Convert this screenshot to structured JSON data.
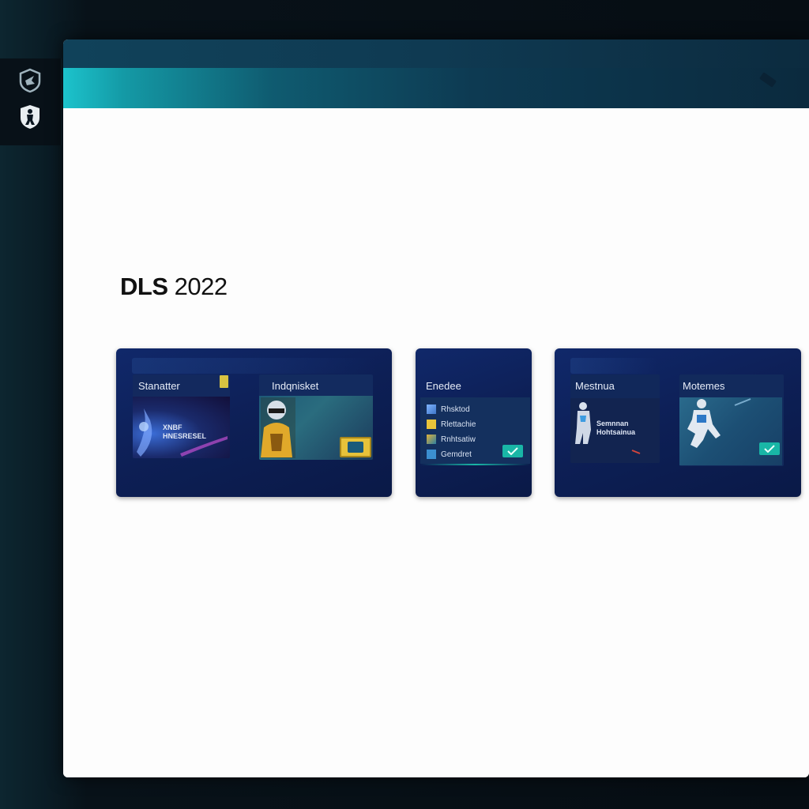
{
  "app": {
    "title": "DLS 2022",
    "title_bold": "DLS",
    "title_rest": " 2022"
  },
  "rail": {
    "items": [
      {
        "icon": "shield-arrow-icon"
      },
      {
        "icon": "player-shield-icon"
      }
    ]
  },
  "cards": [
    {
      "panels": [
        {
          "label": "Stanatter",
          "art_text": "XNBF\nHNESRESEL"
        },
        {
          "label": "Indqnisket"
        }
      ]
    },
    {
      "title": "Enedee",
      "items": [
        "Rhsktod",
        "Rlettachie",
        "Rnhtsatiw",
        "Gemdret"
      ]
    },
    {
      "panels": [
        {
          "label": "Mestnua",
          "art_text": "Semnnan\nHohtsainua"
        },
        {
          "label": "Motemes"
        }
      ]
    }
  ],
  "colors": {
    "accent_teal": "#19b6a6",
    "card_bg": "#0d1f55",
    "tab_gradient_start": "#1cc3cc"
  }
}
